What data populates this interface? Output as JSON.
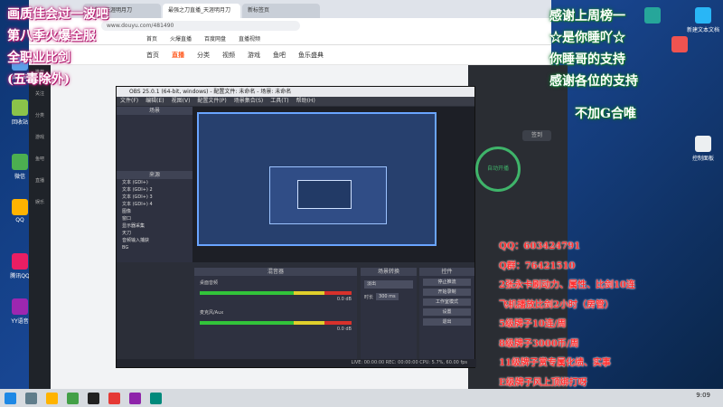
{
  "overlay_left": [
    "画质佳会过一波吧",
    "第八季火爆全服",
    "全职业比剑",
    "(五毒除外)"
  ],
  "overlay_right": [
    "感谢上周榜一",
    "☆是你睡吖☆",
    "你睡哥的支持",
    "感谢各位的支持",
    "不加G合唯"
  ],
  "info_lines": [
    "QQ：603424791",
    "Q群：76421510",
    "2张永卡刷动力、属性、比剑10连",
    "飞机播放比剑2小时（房管）",
    "5级牌子10连/周",
    "8级牌子3000币/周",
    "11级牌子赏专属化绩、实事",
    "E级牌子风上顶绑打呀"
  ],
  "browser": {
    "tabs": [
      "斗鱼 - 天涯明月刀",
      "最强之刀直播_天涯明月刀",
      "新标签页"
    ],
    "url": "www.douyu.com/481490",
    "bookmarks": [
      "首页",
      "火爆直播",
      "百度网盘",
      "直播视频"
    ],
    "site_nav": [
      "首页",
      "直播",
      "分类",
      "视频",
      "游戏",
      "鱼吧",
      "鱼乐盛典"
    ],
    "sidebar": [
      "推荐",
      "关注",
      "分类",
      "游戏",
      "鱼吧",
      "直播",
      "娱乐"
    ],
    "right_labels": [
      "签到",
      "自动开播"
    ]
  },
  "obs": {
    "title": "OBS 25.0.1 (64-bit, windows) - 配置文件: 未命名 - 场景: 未命名",
    "menu": [
      "文件(F)",
      "编辑(E)",
      "视图(V)",
      "配置文件(P)",
      "场景集合(S)",
      "工具(T)",
      "帮助(H)"
    ],
    "scenes_label": "场景",
    "sources_label": "来源",
    "sources": [
      "文本 (GDI+)",
      "文本 (GDI+) 2",
      "文本 (GDI+) 3",
      "文本 (GDI+) 4",
      "图像",
      "窗口",
      "显示器采集",
      "天刀",
      "音频输入捕获",
      "BG"
    ],
    "mixer_label": "混音器",
    "mixer_tracks": [
      "桌面音频",
      "麦克风/Aux"
    ],
    "mixer_db": "0.0 dB",
    "transitions_label": "场景转换",
    "transition_value": "淡出",
    "duration_label": "时长",
    "duration_value": "300 ms",
    "controls_label": "控件",
    "controls": [
      "停止推流",
      "开始录制",
      "工作室模式",
      "设置",
      "退出"
    ],
    "status": "LIVE: 00:00:00  REC: 00:00:00  CPU: 5.7%, 60.00 fps"
  },
  "taskbar": {
    "time": "9:09",
    "date": "2021/5/1"
  },
  "desktop_icons": [
    "此电脑",
    "回收站",
    "微信",
    "QQ",
    "腾讯QQ",
    "YY语音",
    "新建文本文档",
    "控制面板"
  ],
  "accent": "#ff5d23"
}
